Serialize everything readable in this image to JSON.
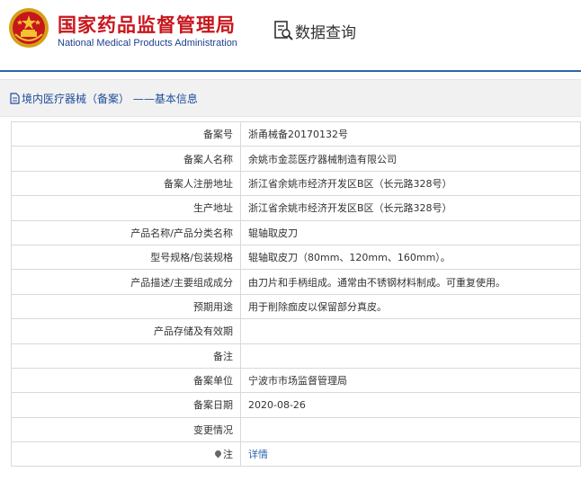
{
  "header": {
    "org_name_cn": "国家药品监督管理局",
    "org_name_en": "National Medical Products Administration",
    "emblem_icon": "national-emblem-icon",
    "query_icon": "data-query-icon",
    "query_title": "数据查询"
  },
  "section": {
    "icon": "document-icon",
    "title": "境内医疗器械（备案） ——基本信息"
  },
  "details": {
    "rows": [
      {
        "label": "备案号",
        "value": "浙甬械备20170132号"
      },
      {
        "label": "备案人名称",
        "value": "余姚市金蕊医疗器械制造有限公司"
      },
      {
        "label": "备案人注册地址",
        "value": "浙江省余姚市经济开发区B区（长元路328号）"
      },
      {
        "label": "生产地址",
        "value": "浙江省余姚市经济开发区B区（长元路328号）"
      },
      {
        "label": "产品名称/产品分类名称",
        "value": "辊轴取皮刀"
      },
      {
        "label": "型号规格/包装规格",
        "value": "辊轴取皮刀（80mm、120mm、160mm）。"
      },
      {
        "label": "产品描述/主要组成成分",
        "value": "由刀片和手柄组成。通常由不锈钢材料制成。可重复使用。"
      },
      {
        "label": "预期用途",
        "value": "用于削除痂皮以保留部分真皮。"
      },
      {
        "label": "产品存储及有效期",
        "value": ""
      },
      {
        "label": "备注",
        "value": ""
      },
      {
        "label": "备案单位",
        "value": "宁波市市场监督管理局"
      },
      {
        "label": "备案日期",
        "value": "2020-08-26"
      },
      {
        "label": "变更情况",
        "value": ""
      }
    ],
    "note_row": {
      "icon": "pin-icon",
      "label": "注",
      "link_text": "详情"
    }
  },
  "colors": {
    "brand_red": "#c8161d",
    "brand_blue": "#1f3f8f",
    "link_blue": "#2b66b0"
  }
}
